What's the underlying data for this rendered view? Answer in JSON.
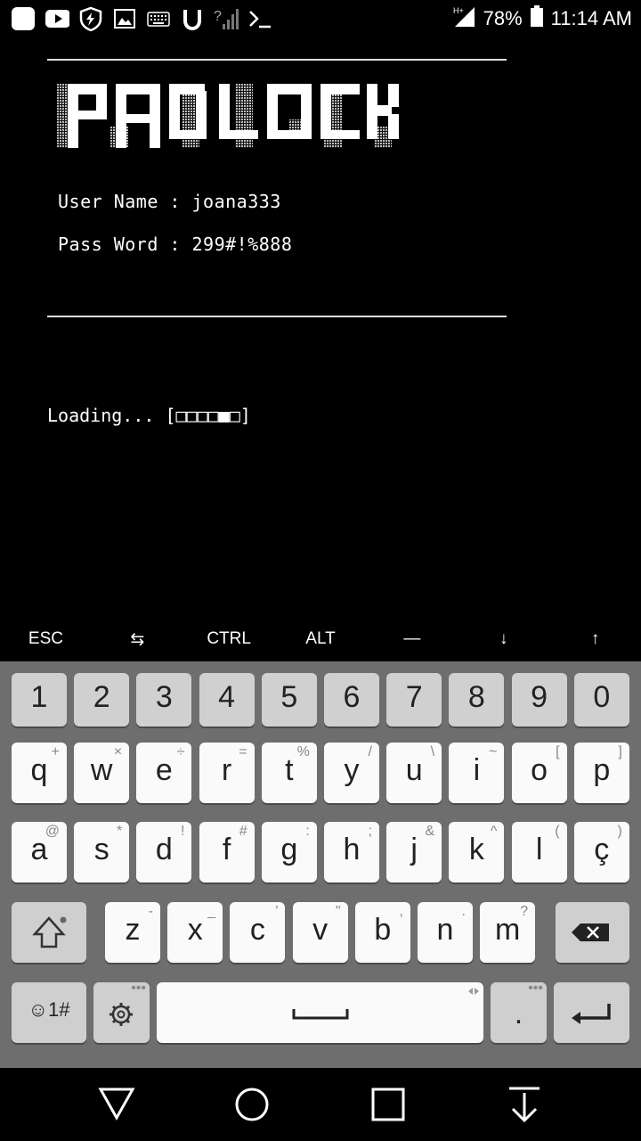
{
  "status_bar": {
    "battery": "78%",
    "time": "11:14 AM",
    "network": "H+",
    "left_icons": [
      "app-icon",
      "youtube-icon",
      "shield-icon",
      "image-icon",
      "keyboard-icon",
      "u-icon",
      "signal-unknown-icon",
      "terminal-icon"
    ]
  },
  "terminal": {
    "logo_text": "PADLOCK",
    "username_line": "User Name : joana333",
    "password_line": "Pass Word : 299#!%888",
    "loading_line": "Loading... [□□□□■□]"
  },
  "extra_keys": [
    "ESC",
    "⇆",
    "CTRL",
    "ALT",
    "—",
    "↓",
    "↑"
  ],
  "keyboard": {
    "numbers": [
      "1",
      "2",
      "3",
      "4",
      "5",
      "6",
      "7",
      "8",
      "9",
      "0"
    ],
    "row1": [
      {
        "k": "q",
        "h": "+"
      },
      {
        "k": "w",
        "h": "×"
      },
      {
        "k": "e",
        "h": "÷"
      },
      {
        "k": "r",
        "h": "="
      },
      {
        "k": "t",
        "h": "%"
      },
      {
        "k": "y",
        "h": "/"
      },
      {
        "k": "u",
        "h": "\\"
      },
      {
        "k": "i",
        "h": "~"
      },
      {
        "k": "o",
        "h": "["
      },
      {
        "k": "p",
        "h": "]"
      }
    ],
    "row2": [
      {
        "k": "a",
        "h": "@"
      },
      {
        "k": "s",
        "h": "*"
      },
      {
        "k": "d",
        "h": "!"
      },
      {
        "k": "f",
        "h": "#"
      },
      {
        "k": "g",
        "h": ":"
      },
      {
        "k": "h",
        "h": ";"
      },
      {
        "k": "j",
        "h": "&"
      },
      {
        "k": "k",
        "h": "^"
      },
      {
        "k": "l",
        "h": "("
      },
      {
        "k": "ç",
        "h": ")"
      }
    ],
    "row3": [
      {
        "k": "z",
        "h": "-"
      },
      {
        "k": "x",
        "h": "_"
      },
      {
        "k": "c",
        "h": "'"
      },
      {
        "k": "v",
        "h": "\""
      },
      {
        "k": "b",
        "h": ","
      },
      {
        "k": "n",
        "h": "."
      },
      {
        "k": "m",
        "h": "?"
      }
    ],
    "symbols_label": "☺1#",
    "period_label": "."
  }
}
